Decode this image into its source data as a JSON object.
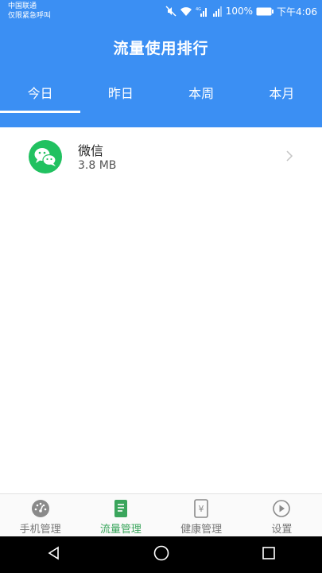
{
  "status_bar": {
    "carrier_line1": "中国联通",
    "carrier_line2": "仅限紧急呼叫",
    "battery": "100%",
    "time": "下午4:06",
    "icons": [
      "mute-icon",
      "wifi-icon",
      "signal-4g-icon",
      "signal-icon",
      "battery-icon"
    ]
  },
  "header": {
    "title": "流量使用排行",
    "tabs": [
      {
        "label": "今日",
        "active": true
      },
      {
        "label": "昨日",
        "active": false
      },
      {
        "label": "本周",
        "active": false
      },
      {
        "label": "本月",
        "active": false
      }
    ]
  },
  "apps": [
    {
      "name": "微信",
      "usage": "3.8 MB",
      "icon": "wechat-icon"
    }
  ],
  "bottom_nav": {
    "items": [
      {
        "label": "手机管理",
        "icon": "speedometer-icon",
        "active": false
      },
      {
        "label": "流量管理",
        "icon": "document-icon",
        "active": true
      },
      {
        "label": "健康管理",
        "icon": "yen-icon",
        "active": false
      },
      {
        "label": "设置",
        "icon": "play-circle-icon",
        "active": false
      }
    ]
  },
  "colors": {
    "header": "#3b8ff3",
    "nav_active": "#3aa55c",
    "wechat_green": "#21c160"
  }
}
